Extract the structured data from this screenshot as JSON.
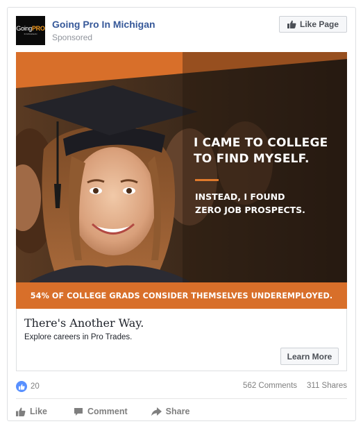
{
  "post": {
    "page_name": "Going Pro In Michigan",
    "sponsored_label": "Sponsored",
    "like_page_label": "Like Page",
    "logo": {
      "going": "Going",
      "pro": "PRO",
      "sub": "IN MICHIGAN"
    }
  },
  "ad": {
    "headline_line1": "I CAME TO COLLEGE",
    "headline_line2": "TO FIND MYSELF.",
    "subhead_line1": "INSTEAD, I FOUND",
    "subhead_line2": "ZERO JOB PROSPECTS.",
    "banner": "54% OF COLLEGE GRADS CONSIDER THEMSELVES UNDEREMPLOYED.",
    "accent_color": "#d86f2a"
  },
  "link": {
    "title": "There's Another Way.",
    "description": "Explore careers in Pro Trades.",
    "cta_label": "Learn More"
  },
  "stats": {
    "reactions_count": "20",
    "comments": "562 Comments",
    "shares": "311 Shares"
  },
  "actions": {
    "like": "Like",
    "comment": "Comment",
    "share": "Share"
  }
}
